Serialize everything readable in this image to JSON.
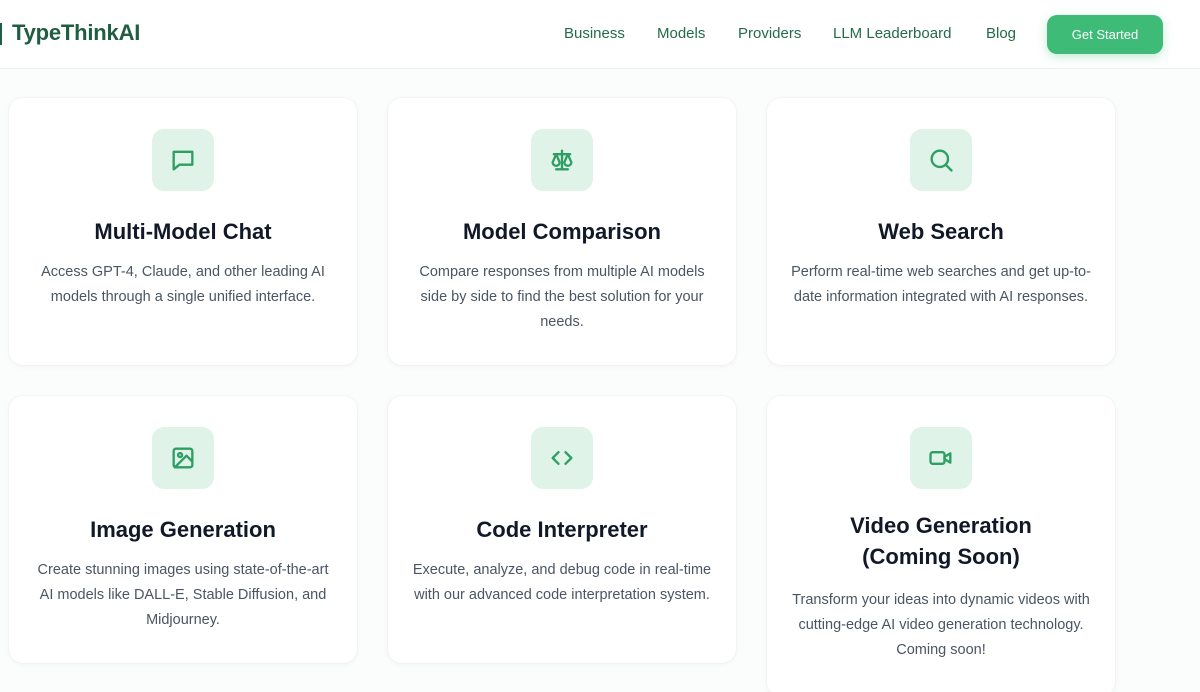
{
  "brand": {
    "name": "TypeThinkAI"
  },
  "nav": {
    "links": [
      "Business",
      "Models",
      "Providers",
      "LLM Leaderboard",
      "Blog"
    ],
    "cta_label": "Get Started"
  },
  "colors": {
    "brand": "#1f5e42",
    "accent": "#3dbb77",
    "icon_bg": "#dff3e8",
    "icon_stroke": "#2f9e63"
  },
  "features": [
    {
      "icon": "chat-bubble-icon",
      "title": "Multi-Model Chat",
      "description": "Access GPT-4, Claude, and other leading AI models through a single unified interface."
    },
    {
      "icon": "scales-icon",
      "title": "Model Comparison",
      "description": "Compare responses from multiple AI models side by side to find the best solution for your needs."
    },
    {
      "icon": "search-icon",
      "title": "Web Search",
      "description": "Perform real-time web searches and get up-to-date information integrated with AI responses."
    },
    {
      "icon": "image-icon",
      "title": "Image Generation",
      "description": "Create stunning images using state-of-the-art AI models like DALL-E, Stable Diffusion, and Midjourney."
    },
    {
      "icon": "code-icon",
      "title": "Code Interpreter",
      "description": "Execute, analyze, and debug code in real-time with our advanced code interpretation system."
    },
    {
      "icon": "video-camera-icon",
      "title": "Video Generation (Coming Soon)",
      "description": "Transform your ideas into dynamic videos with cutting-edge AI video generation technology. Coming soon!"
    }
  ]
}
